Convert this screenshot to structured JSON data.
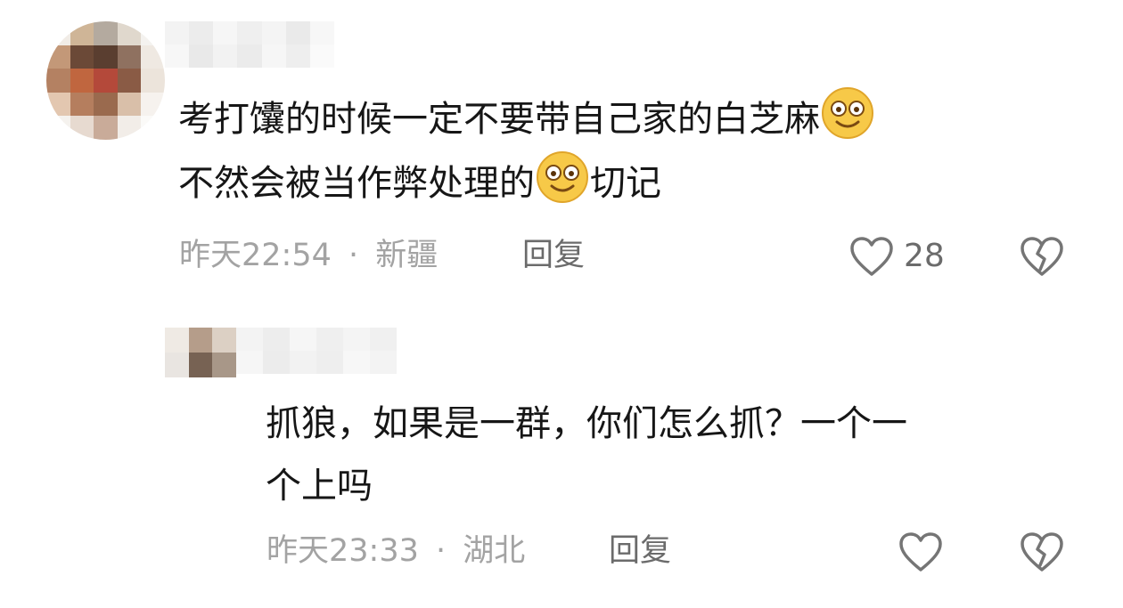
{
  "comments": [
    {
      "lines": [
        "考打馕的时候一定不要带自己家的白芝麻",
        "不然会被当作弊处理的",
        "切记"
      ],
      "time": "昨天22:54",
      "separator": "·",
      "location": "新疆",
      "reply_label": "回复",
      "likes": "28",
      "emojis": [
        "smiling-face-emoji",
        "smiling-face-emoji"
      ]
    },
    {
      "lines": [
        "抓狼，如果是一群，你们怎么抓？一个一",
        "个上吗"
      ],
      "time": "昨天23:33",
      "separator": "·",
      "location": "湖北",
      "reply_label": "回复"
    }
  ],
  "icons": [
    "heart-outline-icon",
    "broken-heart-icon"
  ]
}
